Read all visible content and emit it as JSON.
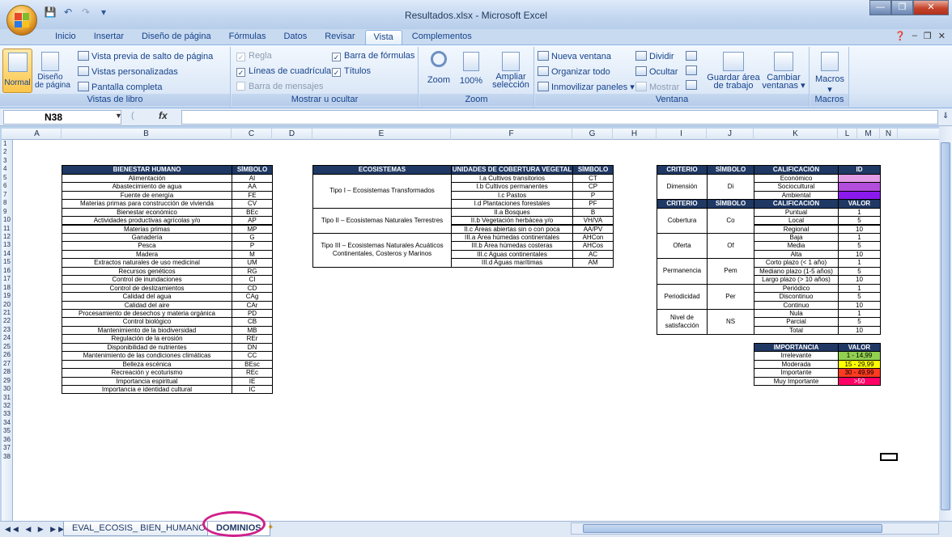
{
  "window": {
    "title": "Resultados.xlsx - Microsoft Excel"
  },
  "tabs": [
    "Inicio",
    "Insertar",
    "Diseño de página",
    "Fórmulas",
    "Datos",
    "Revisar",
    "Vista",
    "Complementos"
  ],
  "active_tab": "Vista",
  "ribbon": {
    "vistas_libro": {
      "label": "Vistas de libro",
      "normal": "Normal",
      "diseno": "Diseño",
      "diseno2": "de página",
      "salto": "Vista previa de salto de página",
      "personalizadas": "Vistas personalizadas",
      "completa": "Pantalla completa"
    },
    "mostrar": {
      "label": "Mostrar u ocultar",
      "regla": "Regla",
      "lineas": "Líneas de cuadrícula",
      "mensajes": "Barra de mensajes",
      "formulas": "Barra de fórmulas",
      "titulos": "Títulos"
    },
    "zoom": {
      "label": "Zoom",
      "zoom": "Zoom",
      "pct": "100%",
      "ampliar": "Ampliar",
      "seleccion": "selección"
    },
    "ventana": {
      "label": "Ventana",
      "nueva": "Nueva ventana",
      "organizar": "Organizar todo",
      "inmovilizar": "Inmovilizar paneles",
      "dividir": "Dividir",
      "ocultar": "Ocultar",
      "mostrar": "Mostrar",
      "guardar": "Guardar área",
      "guardar2": "de trabajo",
      "cambiar": "Cambiar",
      "cambiar2": "ventanas"
    },
    "macros": {
      "label": "Macros",
      "macros": "Macros"
    }
  },
  "formula_bar": {
    "name_box": "N38",
    "fx": "fx",
    "value": ""
  },
  "columns": [
    "A",
    "B",
    "C",
    "D",
    "E",
    "F",
    "G",
    "H",
    "I",
    "J",
    "K",
    "L",
    "M",
    "N"
  ],
  "rows": [
    "1",
    "2",
    "3",
    "4",
    "5",
    "6",
    "7",
    "8",
    "9",
    "10",
    "11",
    "12",
    "13",
    "14",
    "15",
    "16",
    "17",
    "18",
    "19",
    "20",
    "21",
    "22",
    "23",
    "24",
    "25",
    "26",
    "27",
    "28",
    "29",
    "30",
    "31",
    "32",
    "33",
    "34",
    "35",
    "36",
    "37",
    "38"
  ],
  "bienestar": {
    "header": [
      "BIENESTAR HUMANO",
      "SÍMBOLO"
    ],
    "rows": [
      [
        "Alimentación",
        "AI"
      ],
      [
        "Abastecimiento de agua",
        "AA"
      ],
      [
        "Fuente de energía",
        "FE"
      ],
      [
        "Materias primas para construcción de vivienda",
        "CV"
      ],
      [
        "Bienestar económico",
        "BEc"
      ],
      [
        "Actividades productivas agrícolas y/o",
        "AP"
      ],
      [
        "Materias primas",
        "MP"
      ],
      [
        "Ganadería",
        "G"
      ],
      [
        "Pesca",
        "P"
      ],
      [
        "Madera",
        "M"
      ],
      [
        "Extractos naturales de uso medicinal",
        "UM"
      ],
      [
        "Recursos genéticos",
        "RG"
      ],
      [
        "Control de inundaciones",
        "CI"
      ],
      [
        "Control de deslizamientos",
        "CD"
      ],
      [
        "Calidad del agua",
        "CAg"
      ],
      [
        "Calidad del aire",
        "CAr"
      ],
      [
        "Procesamiento de desechos y materia orgánica",
        "PD"
      ],
      [
        "Control biológico",
        "CB"
      ],
      [
        "Mantenimiento de la biodiversidad",
        "MB"
      ],
      [
        "Regulación de la erosión",
        "REr"
      ],
      [
        "Disponibilidad de nutrientes",
        "DN"
      ],
      [
        "Mantenimiento de las condiciones climáticas",
        "CC"
      ],
      [
        "Belleza escénica",
        "BEsc"
      ],
      [
        "Recreación y ecoturismo",
        "REc"
      ],
      [
        "Importancia espiritual",
        "IE"
      ],
      [
        "Importancia e identidad cultural",
        "IC"
      ]
    ]
  },
  "ecosistemas": {
    "header": [
      "ECOSISTEMAS",
      "UNIDADES DE COBERTURA VEGETAL",
      "SÍMBOLO"
    ],
    "groups": [
      "Tipo I – Ecosistemas Transformados",
      "Tipo II – Ecosistemas Naturales Terrestres",
      "Tipo III – Ecosistemas Naturales Acuáticos Continentales, Costeros y Marinos"
    ],
    "rows": [
      [
        "I.a Cultivos transitorios",
        "CT"
      ],
      [
        "I.b Cultivos permanentes",
        "CP"
      ],
      [
        "I.c Pastos",
        "P"
      ],
      [
        "I.d Plantaciones forestales",
        "PF"
      ],
      [
        "II.a Bosques",
        "B"
      ],
      [
        "II.b Vegetación herbácea y/o",
        "VH/VA"
      ],
      [
        "II.c Áreas abiertas sin o con poca",
        "AA/PV"
      ],
      [
        "III.a Área húmedas continentales",
        "AHCon"
      ],
      [
        "III.b Área húmedas costeras",
        "AHCos"
      ],
      [
        "III.c Aguas continentales",
        "AC"
      ],
      [
        "III.d Aguas marítimas",
        "AM"
      ]
    ]
  },
  "criterios": {
    "header1": [
      "CRITERIO",
      "SÍMBOLO",
      "CALIFICACIÓN",
      "ID"
    ],
    "dimension": {
      "criterio": "Dimensión",
      "simbolo": "Di",
      "items": [
        "Económico",
        "Sociocultural",
        "Ambiental"
      ],
      "colors": [
        "#e29de6",
        "#b24ddc",
        "#8a19ee"
      ]
    },
    "header2": [
      "CRITERIO",
      "SÍMBOLO",
      "CALIFICACIÓN",
      "VALOR"
    ],
    "groups": [
      {
        "criterio": "Cobertura",
        "simbolo": "Co",
        "items": [
          [
            "Puntual",
            "1"
          ],
          [
            "Local",
            "5"
          ],
          [
            "Regional",
            "10"
          ]
        ]
      },
      {
        "criterio": "Oferta",
        "simbolo": "Of",
        "items": [
          [
            "Baja",
            "1"
          ],
          [
            "Media",
            "5"
          ],
          [
            "Alta",
            "10"
          ]
        ]
      },
      {
        "criterio": "Permanencia",
        "simbolo": "Pem",
        "items": [
          [
            "Corto plazo (< 1 año)",
            "1"
          ],
          [
            "Mediano plazo (1-5 años)",
            "5"
          ],
          [
            "Largo plazo (> 10 años)",
            "10"
          ]
        ]
      },
      {
        "criterio": "Periodicidad",
        "simbolo": "Per",
        "items": [
          [
            "Periódico",
            "1"
          ],
          [
            "Discontinuo",
            "5"
          ],
          [
            "Continuo",
            "10"
          ]
        ]
      },
      {
        "criterio": "Nivel de satisfacción",
        "simbolo": "NS",
        "items": [
          [
            "Nula",
            "1"
          ],
          [
            "Parcial",
            "5"
          ],
          [
            "Total",
            "10"
          ]
        ]
      }
    ]
  },
  "importancia": {
    "header": [
      "IMPORTANCIA",
      "VALOR"
    ],
    "rows": [
      [
        "Irrelevante",
        "1 - 14,99"
      ],
      [
        "Moderada",
        "15 - 29,99"
      ],
      [
        "Importante",
        "30 - 49,99"
      ],
      [
        "Muy Importante",
        ">50"
      ]
    ],
    "colors": [
      "#92d050",
      "#ffff00",
      "#ff3b1f",
      "#ff0066"
    ]
  },
  "sheet_tabs": [
    "EVAL_ECOSIS_ BIEN_HUMANO",
    "DOMINIOS"
  ],
  "active_sheet": "DOMINIOS"
}
